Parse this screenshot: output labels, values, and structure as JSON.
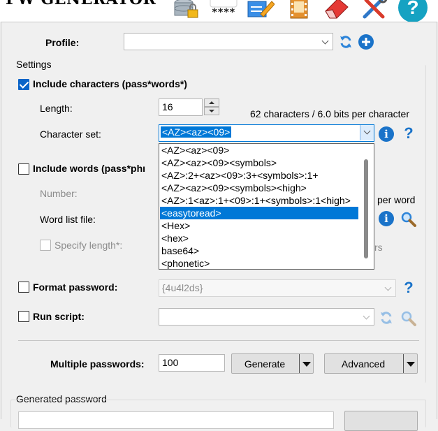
{
  "app": {
    "title": "PW GENERATOR"
  },
  "toolbar": [
    {
      "name": "database-lock-icon",
      "tooltip": ""
    },
    {
      "name": "password-dots-icon",
      "glyph": "****"
    },
    {
      "name": "edit-icon"
    },
    {
      "name": "film-icon"
    },
    {
      "name": "eraser-icon"
    },
    {
      "name": "tools-icon"
    },
    {
      "name": "help-icon",
      "glyph": "?"
    }
  ],
  "profile": {
    "label": "Profile:",
    "value": ""
  },
  "settings": {
    "label": "Settings"
  },
  "characters": {
    "checkbox_label": "Include characters (pass*words*)",
    "checked": true,
    "length_label": "Length:",
    "length_value": "16",
    "stats": "62 characters / 6.0 bits per character",
    "charset_label": "Character set:",
    "charset_value": "<AZ><az><09>",
    "charset_options": [
      "<AZ><az><09>",
      "<AZ><az><09><symbols>",
      "<AZ>:2+<az><09>:3+<symbols>:1+",
      "<AZ><az><09><symbols><high>",
      "<AZ>:1<az>:1+<09>:1+<symbols>:1<high>",
      "<easytoread>",
      "<Hex>",
      "<hex>",
      "base64>",
      "<phonetic>"
    ],
    "highlighted_option": 5
  },
  "words": {
    "checkbox_label": "Include words (pass*phrases*)",
    "checkbox_label_visible": "Include words (pass*phı",
    "checked": false,
    "number_label": "Number:",
    "stats_suffix": "per word",
    "wordlist_label": "Word list file:",
    "specify_length_label": "Specify length*:",
    "specify_suffix": "rs"
  },
  "format": {
    "checkbox_label": "Format password:",
    "value": "{4u4l2ds}"
  },
  "script": {
    "checkbox_label": "Run script:",
    "value": ""
  },
  "multiple": {
    "label": "Multiple passwords:",
    "value": "100",
    "generate_label": "Generate",
    "advanced_label": "Advanced"
  },
  "generated": {
    "label": "Generated password"
  },
  "colors": {
    "accent": "#0078d7",
    "info": "#1a73c9",
    "highlight": "#0078d7"
  }
}
